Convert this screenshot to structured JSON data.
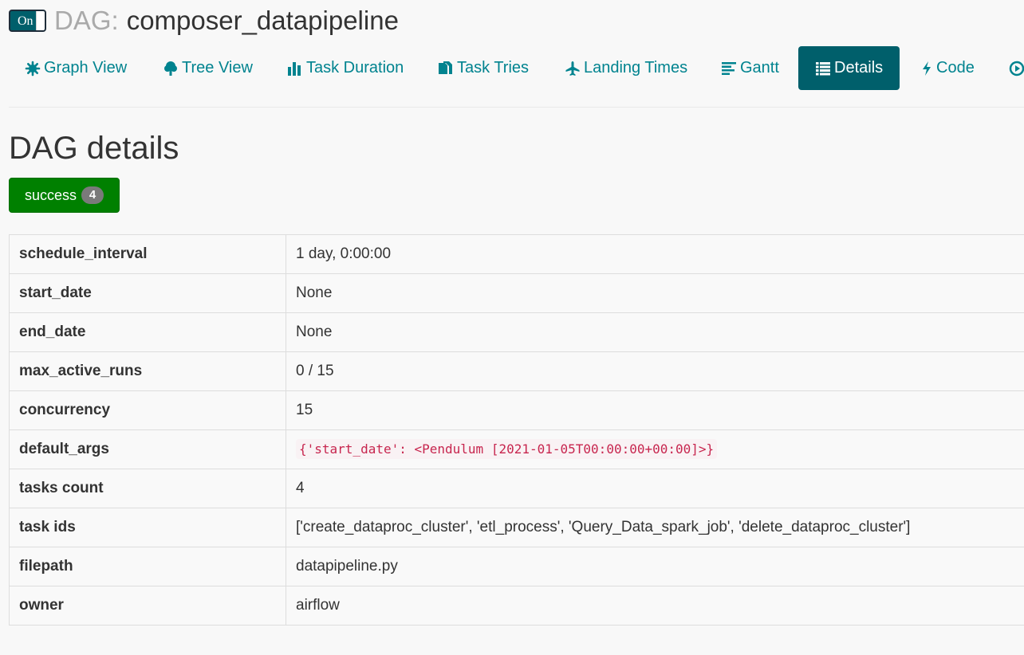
{
  "header": {
    "toggle_label": "On",
    "prefix": "DAG:",
    "dag_name": "composer_datapipeline"
  },
  "nav": {
    "items": [
      {
        "label": "Graph View",
        "icon": "asterisk-icon"
      },
      {
        "label": "Tree View",
        "icon": "tree-icon"
      },
      {
        "label": "Task Duration",
        "icon": "bar-chart-icon"
      },
      {
        "label": "Task Tries",
        "icon": "duplicate-files-icon"
      },
      {
        "label": "Landing Times",
        "icon": "plane-icon"
      },
      {
        "label": "Gantt",
        "icon": "align-left-icon"
      },
      {
        "label": "Details",
        "icon": "list-icon",
        "active": true
      },
      {
        "label": "Code",
        "icon": "flash-icon"
      }
    ]
  },
  "page": {
    "title": "DAG details"
  },
  "status": {
    "label": "success",
    "count": "4"
  },
  "details": {
    "rows": [
      {
        "key": "schedule_interval",
        "value": "1 day, 0:00:00"
      },
      {
        "key": "start_date",
        "value": "None"
      },
      {
        "key": "end_date",
        "value": "None"
      },
      {
        "key": "max_active_runs",
        "value": "0 / 15"
      },
      {
        "key": "concurrency",
        "value": "15"
      },
      {
        "key": "default_args",
        "value": "{'start_date': <Pendulum [2021-01-05T00:00:00+00:00]>}"
      },
      {
        "key": "tasks count",
        "value": "4"
      },
      {
        "key": "task ids",
        "value": "['create_dataproc_cluster', 'etl_process', 'Query_Data_spark_job', 'delete_dataproc_cluster']"
      },
      {
        "key": "filepath",
        "value": "datapipeline.py"
      },
      {
        "key": "owner",
        "value": "airflow"
      }
    ]
  },
  "colors": {
    "link": "#00838f",
    "active_tab": "#005f6b",
    "success": "#008000",
    "code_text": "#c7254e"
  }
}
